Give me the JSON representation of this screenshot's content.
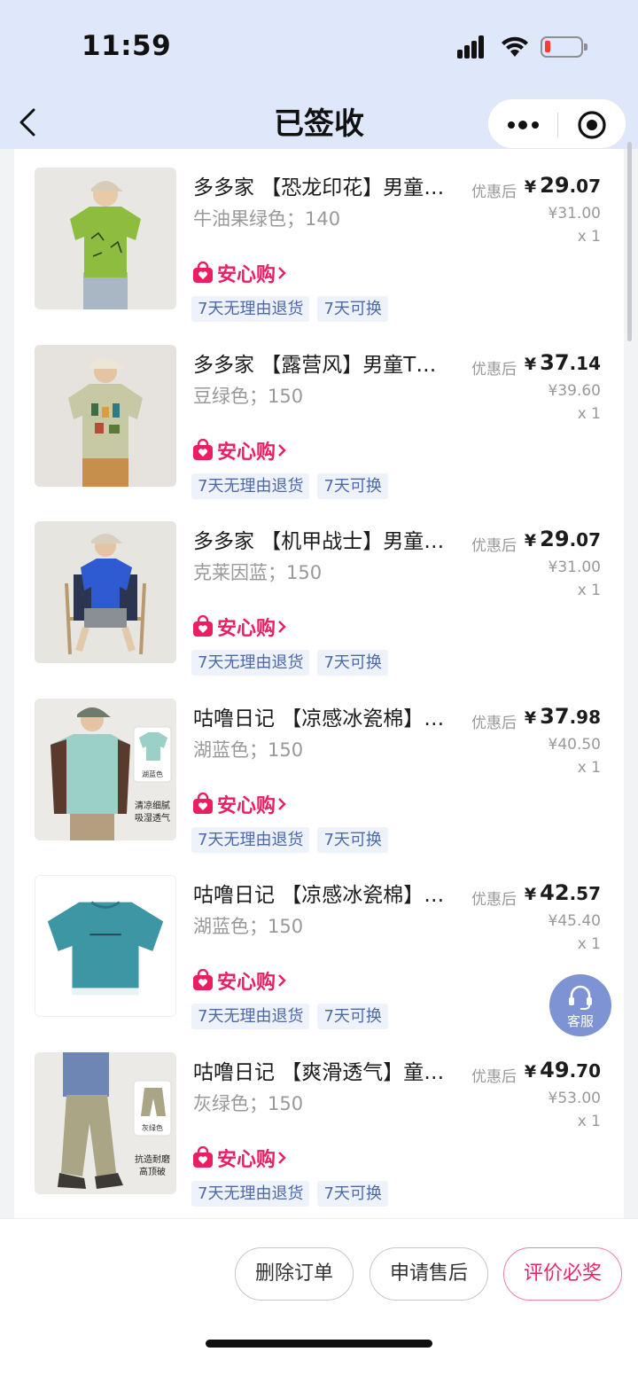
{
  "status_bar": {
    "time": "11:59"
  },
  "nav": {
    "title": "已签收"
  },
  "discount_label": "优惠后",
  "anxin_label": "安心购",
  "items": [
    {
      "title": "多多家 【恐龙印花】男童…",
      "spec": "牛油果绿色；140",
      "price_currency": "¥",
      "price_int": "29",
      "price_dec": ".07",
      "original_price": "¥31.00",
      "quantity": "x 1",
      "tags": [
        "7天无理由退货",
        "7天可换"
      ]
    },
    {
      "title": "多多家 【露营风】男童T…",
      "spec": "豆绿色；150",
      "price_currency": "¥",
      "price_int": "37",
      "price_dec": ".14",
      "original_price": "¥39.60",
      "quantity": "x 1",
      "tags": [
        "7天无理由退货",
        "7天可换"
      ]
    },
    {
      "title": "多多家 【机甲战士】男童…",
      "spec": "克莱因蓝；150",
      "price_currency": "¥",
      "price_int": "29",
      "price_dec": ".07",
      "original_price": "¥31.00",
      "quantity": "x 1",
      "tags": [
        "7天无理由退货",
        "7天可换"
      ]
    },
    {
      "title": "咕噜日记 【凉感冰瓷棉】…",
      "spec": "湖蓝色；150",
      "price_currency": "¥",
      "price_int": "37",
      "price_dec": ".98",
      "original_price": "¥40.50",
      "quantity": "x 1",
      "tags": [
        "7天无理由退货",
        "7天可换"
      ],
      "image_text": [
        "湖蓝色",
        "清凉细腻",
        "吸湿透气"
      ]
    },
    {
      "title": "咕噜日记 【凉感冰瓷棉】…",
      "spec": "湖蓝色；150",
      "price_currency": "¥",
      "price_int": "42",
      "price_dec": ".57",
      "original_price": "¥45.40",
      "quantity": "x 1",
      "tags": [
        "7天无理由退货",
        "7天可换"
      ]
    },
    {
      "title": "咕噜日记 【爽滑透气】童…",
      "spec": "灰绿色；150",
      "price_currency": "¥",
      "price_int": "49",
      "price_dec": ".70",
      "original_price": "¥53.00",
      "quantity": "x 1",
      "tags": [
        "7天无理由退货",
        "7天可换"
      ],
      "image_text": [
        "灰绿色",
        "抗造耐磨",
        "高顶破"
      ]
    }
  ],
  "customer_service": {
    "label": "客服"
  },
  "actions": {
    "delete_order": "删除订单",
    "after_sales": "申请售后",
    "review": "评价必奖"
  },
  "colors": {
    "header_bg": "#dfe7fa",
    "anxin_pink": "#ec1e63",
    "tag_bg": "#eef2fb",
    "tag_text": "#4d6aa6",
    "review_red": "#e8246a",
    "cs_bg": "#7d93d3"
  },
  "icons": [
    "back-chevron-icon",
    "more-dots-icon",
    "target-circle-icon",
    "bag-heart-icon",
    "headset-icon",
    "signal-icon",
    "wifi-icon",
    "battery-icon"
  ]
}
